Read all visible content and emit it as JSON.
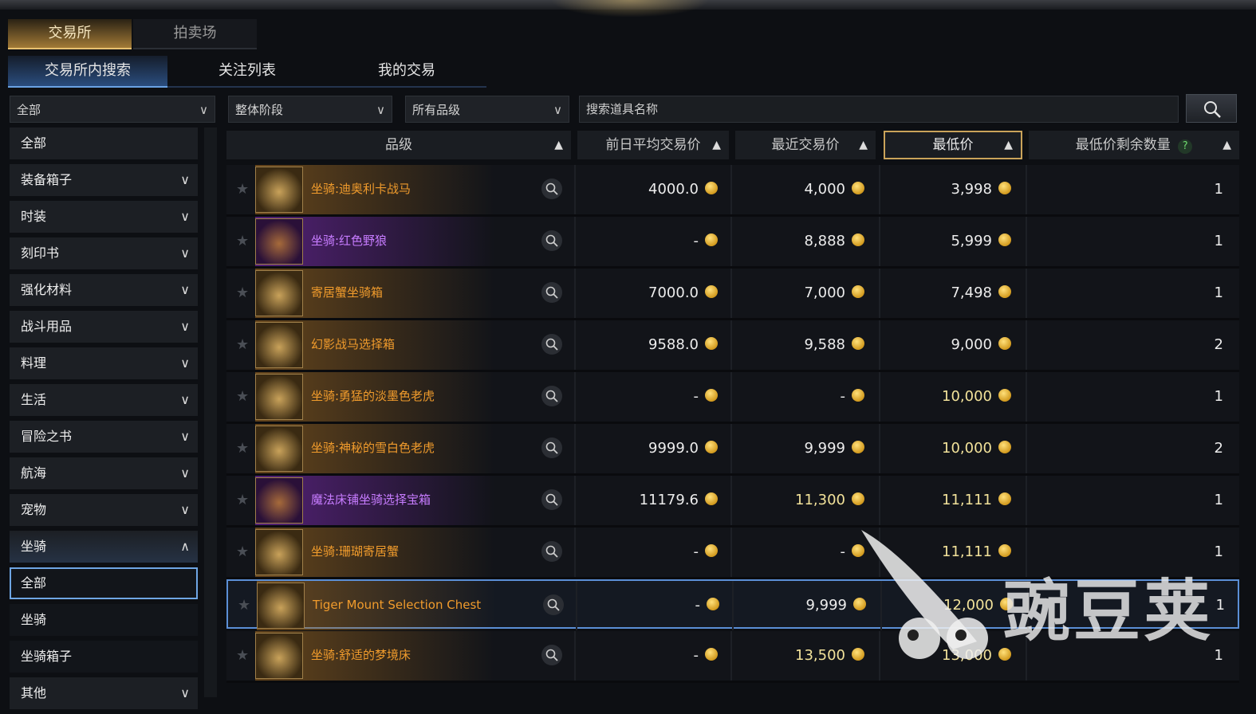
{
  "main_tabs": [
    "交易所",
    "拍卖场"
  ],
  "sub_tabs": [
    "交易所内搜索",
    "关注列表",
    "我的交易"
  ],
  "filters": {
    "category": "全部",
    "stage": "整体阶段",
    "grade": "所有品级",
    "search_placeholder": "搜索道具名称"
  },
  "sidebar": [
    {
      "label": "全部",
      "type": "item"
    },
    {
      "label": "装备箱子",
      "type": "collapsed"
    },
    {
      "label": "时装",
      "type": "collapsed"
    },
    {
      "label": "刻印书",
      "type": "collapsed"
    },
    {
      "label": "强化材料",
      "type": "collapsed"
    },
    {
      "label": "战斗用品",
      "type": "collapsed"
    },
    {
      "label": "料理",
      "type": "collapsed"
    },
    {
      "label": "生活",
      "type": "collapsed"
    },
    {
      "label": "冒险之书",
      "type": "collapsed"
    },
    {
      "label": "航海",
      "type": "collapsed"
    },
    {
      "label": "宠物",
      "type": "collapsed"
    },
    {
      "label": "坐骑",
      "type": "expanded"
    },
    {
      "label": "全部",
      "type": "selected"
    },
    {
      "label": "坐骑",
      "type": "sub"
    },
    {
      "label": "坐骑箱子",
      "type": "sub"
    },
    {
      "label": "其他",
      "type": "collapsed"
    }
  ],
  "columns": {
    "grade": "品级",
    "avg_price": "前日平均交易价",
    "recent_price": "最近交易价",
    "min_price": "最低价",
    "min_qty": "最低价剩余数量",
    "help": "?"
  },
  "rows": [
    {
      "name": "坐骑:迪奥利卡战马",
      "rarity": "legendary",
      "avg": "4000.0",
      "recent": "4,000",
      "min": "3,998",
      "qty": "1"
    },
    {
      "name": "坐骑:红色野狼",
      "rarity": "epic",
      "avg": "-",
      "recent": "8,888",
      "min": "5,999",
      "qty": "1"
    },
    {
      "name": "寄居蟹坐骑箱",
      "rarity": "legendary",
      "avg": "7000.0",
      "recent": "7,000",
      "min": "7,498",
      "qty": "1"
    },
    {
      "name": "幻影战马选择箱",
      "rarity": "legendary",
      "avg": "9588.0",
      "recent": "9,588",
      "min": "9,000",
      "qty": "2"
    },
    {
      "name": "坐骑:勇猛的淡墨色老虎",
      "rarity": "legendary",
      "avg": "-",
      "recent": "-",
      "min": "10,000",
      "qty": "1"
    },
    {
      "name": "坐骑:神秘的雪白色老虎",
      "rarity": "legendary",
      "avg": "9999.0",
      "recent": "9,999",
      "min": "10,000",
      "qty": "2"
    },
    {
      "name": "魔法床铺坐骑选择宝箱",
      "rarity": "epic",
      "avg": "11179.6",
      "recent": "11,300",
      "min": "11,111",
      "qty": "1"
    },
    {
      "name": "坐骑:珊瑚寄居蟹",
      "rarity": "legendary",
      "avg": "-",
      "recent": "-",
      "min": "11,111",
      "qty": "1"
    },
    {
      "name": "Tiger Mount Selection Chest",
      "rarity": "legendary",
      "avg": "-",
      "recent": "9,999",
      "min": "12,000",
      "qty": "1"
    },
    {
      "name": "坐骑:舒适的梦境床",
      "rarity": "legendary",
      "avg": "-",
      "recent": "13,500",
      "min": "13,000",
      "qty": "1"
    }
  ],
  "watermark": "豌豆荚",
  "colors": {
    "legendary": "#f09b2c",
    "epic": "#c77cff",
    "highlight_border": "#5b8fd6",
    "selected_header_border": "#caa35a",
    "coin": "#e3b040"
  }
}
